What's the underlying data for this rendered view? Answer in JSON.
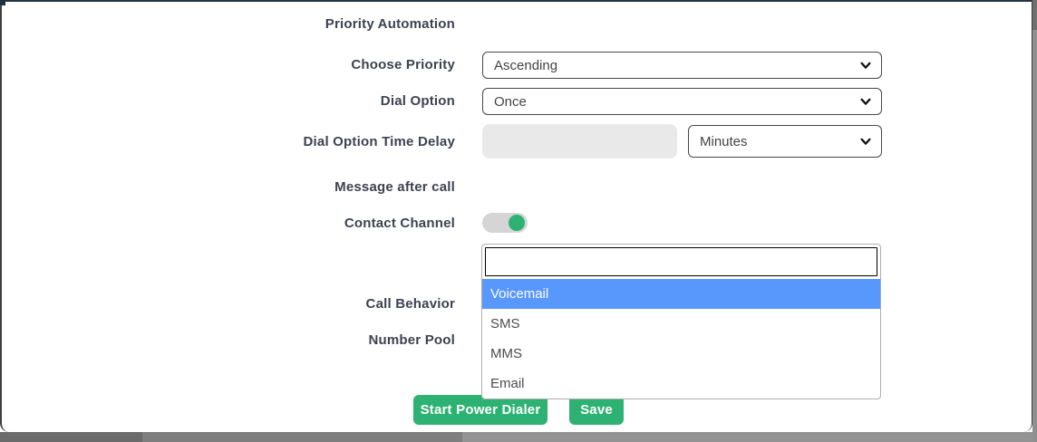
{
  "form": {
    "title": "Priority Automation",
    "choose_priority": {
      "label": "Choose Priority",
      "value": "Ascending"
    },
    "dial_option": {
      "label": "Dial Option",
      "value": "Once"
    },
    "dial_option_time_delay": {
      "label": "Dial Option Time Delay",
      "value": "",
      "unit_value": "Minutes"
    },
    "message_after_call": {
      "label": "Message after call"
    },
    "contact_channel": {
      "label": "Contact Channel",
      "toggle_state": "on"
    },
    "call_behavior": {
      "label": "Call Behavior"
    },
    "number_pool": {
      "label": "Number Pool"
    },
    "channel_dropdown": {
      "search_value": "",
      "options": [
        "Voicemail",
        "SMS",
        "MMS",
        "Email"
      ],
      "highlighted_option": "Voicemail"
    },
    "buttons": {
      "start": "Start Power Dialer",
      "save": "Save"
    }
  },
  "colors": {
    "accent_green": "#2eb273",
    "highlight_blue": "#5897fb",
    "label_text": "#3d4250"
  }
}
